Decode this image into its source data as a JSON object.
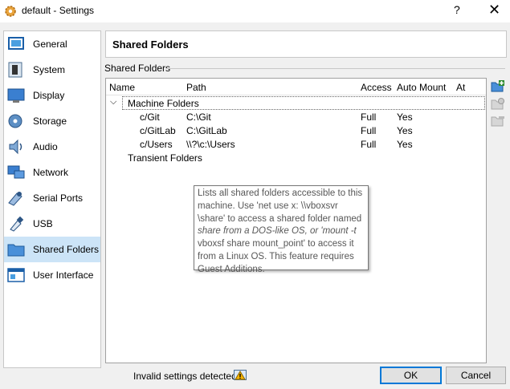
{
  "window": {
    "title": "default - Settings",
    "help": "?",
    "close": "✕"
  },
  "sidebar": {
    "items": [
      {
        "label": "General",
        "icon": "general-icon"
      },
      {
        "label": "System",
        "icon": "chip-icon"
      },
      {
        "label": "Display",
        "icon": "monitor-icon"
      },
      {
        "label": "Storage",
        "icon": "disk-icon"
      },
      {
        "label": "Audio",
        "icon": "speaker-icon"
      },
      {
        "label": "Network",
        "icon": "network-icon"
      },
      {
        "label": "Serial Ports",
        "icon": "serial-port-icon"
      },
      {
        "label": "USB",
        "icon": "usb-icon"
      },
      {
        "label": "Shared Folders",
        "icon": "folder-icon",
        "selected": true
      },
      {
        "label": "User Interface",
        "icon": "user-interface-icon"
      }
    ]
  },
  "page": {
    "title": "Shared Folders",
    "group_label": "Shared Folders"
  },
  "table": {
    "columns": [
      "Name",
      "Path",
      "Access",
      "Auto Mount",
      "At"
    ],
    "expander": "⌵",
    "machine_group": "Machine Folders",
    "rows": [
      {
        "name": "c/Git",
        "path": "C:\\Git",
        "access": "Full",
        "auto_mount": "Yes",
        "at": ""
      },
      {
        "name": "c/GitLab",
        "path": "C:\\GitLab",
        "access": "Full",
        "auto_mount": "Yes",
        "at": ""
      },
      {
        "name": "c/Users",
        "path": "\\\\?\\c:\\Users",
        "access": "Full",
        "auto_mount": "Yes",
        "at": ""
      }
    ],
    "transient_group": "Transient Folders"
  },
  "tooltip": {
    "lines": [
      "Lists all shared folders accessible to this",
      "machine. Use 'net use x: \\\\vboxsvr",
      "\\share' to access a shared folder named",
      "share from a DOS-like OS, or 'mount -t",
      "vboxsf share mount_point' to access it",
      "from a Linux OS. This feature requires",
      "Guest Additions."
    ]
  },
  "status": {
    "text": "Invalid settings detected",
    "icon": "warning-icon"
  },
  "buttons": {
    "ok": "OK",
    "cancel": "Cancel"
  },
  "colors": {
    "selection": "#cce4f7",
    "accent": "#0078d7",
    "add_icon": "#2e8b2e"
  }
}
